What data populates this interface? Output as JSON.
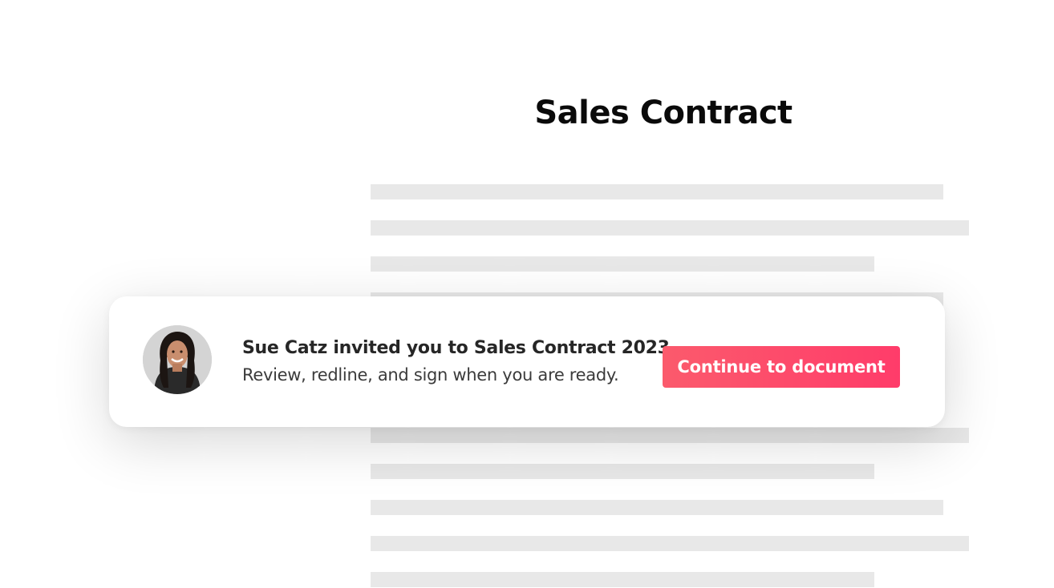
{
  "document": {
    "title": "Sales Contract"
  },
  "invite": {
    "title": "Sue Catz invited you to Sales Contract 2023",
    "subtitle": "Review, redline, and sign when you are ready.",
    "button_label": "Continue to document"
  },
  "colors": {
    "button_gradient_start": "#fb5a6c",
    "button_gradient_end": "#ff3c6a",
    "placeholder_line": "#e8e8e8"
  },
  "icons": {
    "avatar": "user-photo"
  }
}
